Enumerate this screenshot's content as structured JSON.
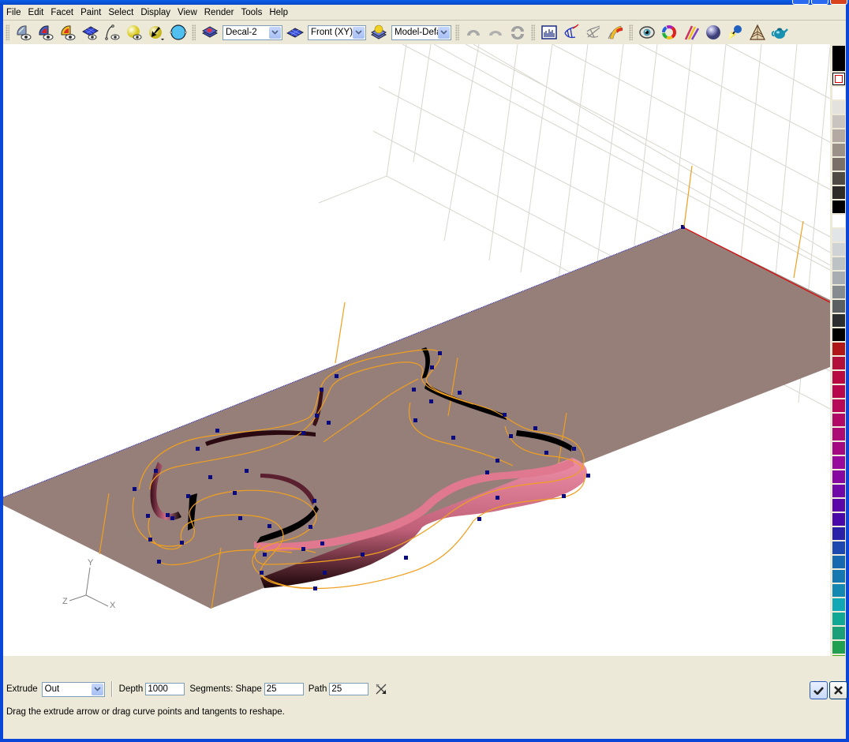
{
  "menubar": {
    "items": [
      "File",
      "Edit",
      "Facet",
      "Paint",
      "Select",
      "Display",
      "View",
      "Render",
      "Tools",
      "Help"
    ]
  },
  "toolbar": {
    "group1": [
      {
        "name": "view-model-icon"
      },
      {
        "name": "view-model-red-icon"
      },
      {
        "name": "view-model-orange-icon"
      },
      {
        "name": "view-grid-plane-icon"
      },
      {
        "name": "view-curve-icon"
      },
      {
        "name": "view-light-sphere-icon"
      },
      {
        "name": "select-arrow-icon"
      },
      {
        "name": "sphere-outline-icon"
      }
    ],
    "decal_select": {
      "value": "Decal-2"
    },
    "view_select": {
      "value": "Front (XY)"
    },
    "material_select": {
      "value": "Model-Defa"
    },
    "group3": [
      {
        "name": "undo-icon"
      },
      {
        "name": "redo-icon"
      },
      {
        "name": "undo-redo-stack-icon"
      }
    ],
    "group4": [
      {
        "name": "histogram-icon"
      },
      {
        "name": "curve-mesh-icon"
      },
      {
        "name": "curve-mesh-gray-icon"
      },
      {
        "name": "surface-paint-icon"
      }
    ],
    "group5": [
      {
        "name": "eye-icon"
      },
      {
        "name": "color-wheel-icon"
      },
      {
        "name": "brushes-icon"
      },
      {
        "name": "shaded-sphere-icon"
      },
      {
        "name": "spotlight-icon"
      },
      {
        "name": "room-icon"
      },
      {
        "name": "teapot-icon"
      }
    ]
  },
  "viewport": {
    "axis_labels": {
      "x": "X",
      "y": "Y",
      "z": "Z"
    },
    "colors": {
      "plane": "#967f79",
      "curve": "#f0a020",
      "extrude": "#e07890",
      "control_point": "#0a0a80",
      "grid": "#d8d6ce",
      "edge_x": "#e00000",
      "edge_z": "#2020c0"
    }
  },
  "palette": {
    "swatches": [
      "#000000",
      "#000000",
      "#ffffff",
      "#e4e2df",
      "#c9c4bf",
      "#b4aaa3",
      "#9c9189",
      "#7a7069",
      "#504a45",
      "#2e2a27",
      "#000000",
      "#ffffff",
      "#e2e5e7",
      "#cfd3d6",
      "#bdc2c5",
      "#a7adb1",
      "#858b8e",
      "#5b6063",
      "#2c2e30",
      "#000000",
      "#b01818",
      "#b0103a",
      "#b80a40",
      "#b8084c",
      "#b80858",
      "#b00a66",
      "#ac0a74",
      "#a40a80",
      "#980a9c",
      "#8608a0",
      "#7008a8",
      "#5c08a8",
      "#4a08a8",
      "#2a20a8",
      "#1c48b0",
      "#1868b0",
      "#1678b0",
      "#1488b0",
      "#10a8b4",
      "#10a894",
      "#1aa078",
      "#20a050",
      "#40b010"
    ],
    "selected_index": 1
  },
  "bottom": {
    "extrude_label": "Extrude",
    "extrude_value": "Out",
    "depth_label": "Depth",
    "depth_value": "1000",
    "segments_label": "Segments: Shape",
    "shape_value": "25",
    "path_label": "Path",
    "path_value": "25",
    "hint": "Drag the extrude arrow or drag curve points and tangents to reshape."
  }
}
